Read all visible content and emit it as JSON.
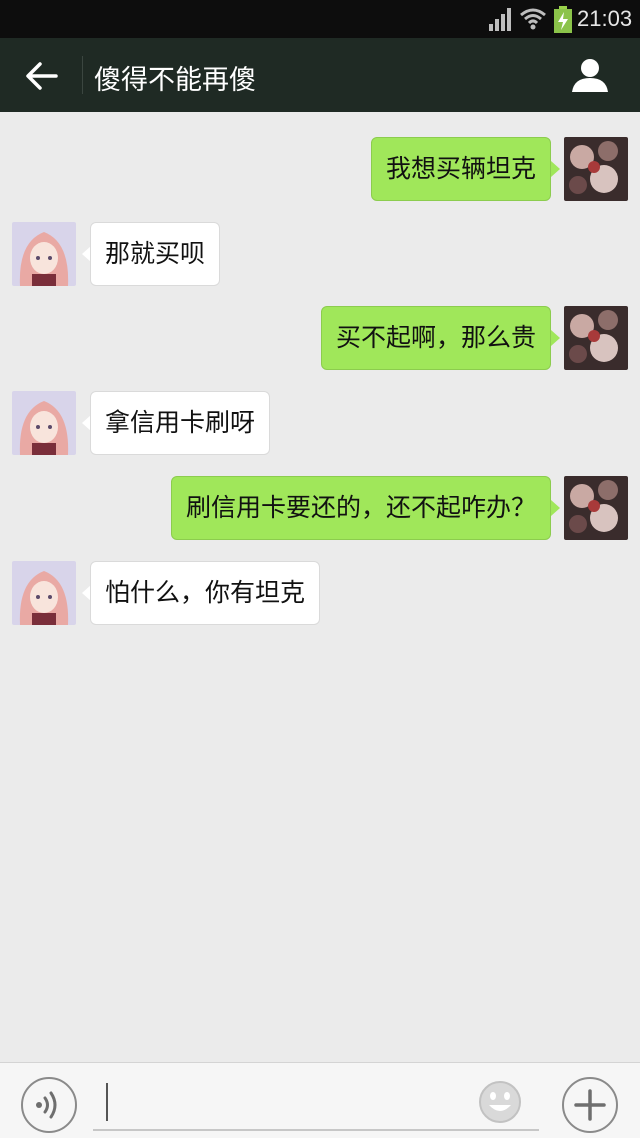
{
  "status_bar": {
    "time": "21:03",
    "icons": [
      "signal-icon",
      "wifi-icon",
      "battery-charging-icon"
    ]
  },
  "header": {
    "back_icon": "arrow-left-icon",
    "title": "傻得不能再傻",
    "profile_icon": "person-icon"
  },
  "messages": [
    {
      "side": "out",
      "text": "我想买辆坦克"
    },
    {
      "side": "in",
      "text": "那就买呗"
    },
    {
      "side": "out",
      "text": "买不起啊，那么贵"
    },
    {
      "side": "in",
      "text": "拿信用卡刷呀"
    },
    {
      "side": "out",
      "text": "刷信用卡要还的，还不起咋办？"
    },
    {
      "side": "in",
      "text": "怕什么，你有坦克"
    }
  ],
  "input_bar": {
    "voice_icon": "voice-icon",
    "input_value": "",
    "emoji_icon": "emoji-icon",
    "plus_icon": "plus-icon"
  },
  "colors": {
    "title_bar": "#1f2a24",
    "chat_background": "#ebebeb",
    "outgoing_bubble": "#a0e75a",
    "incoming_bubble": "#ffffff"
  }
}
